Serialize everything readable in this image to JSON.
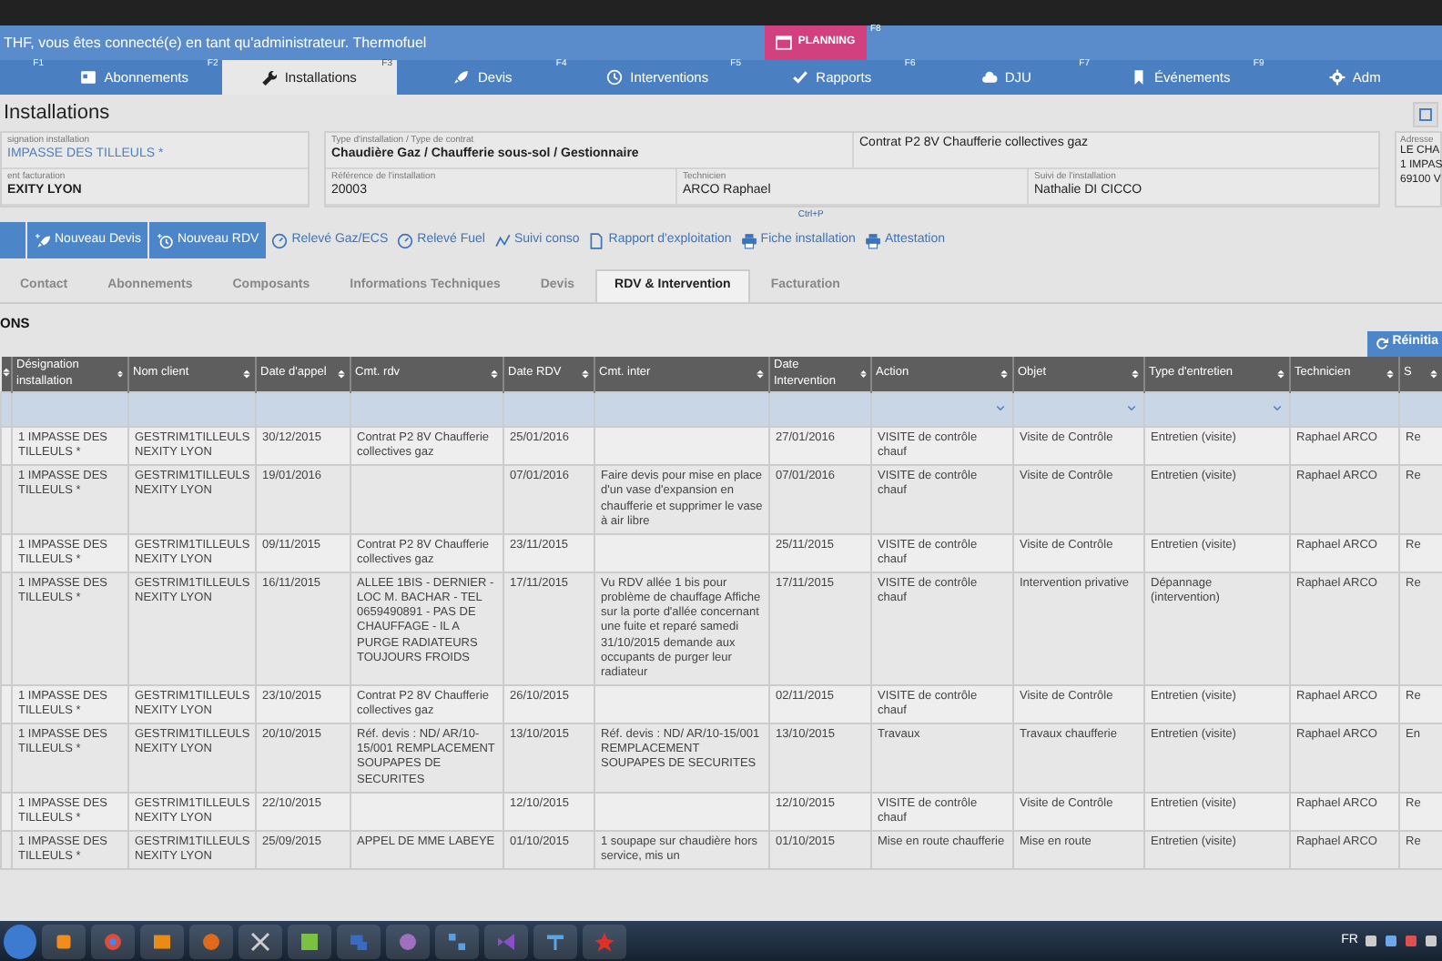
{
  "header": {
    "welcome": "THF, vous êtes connecté(e) en tant qu'administrateur. Thermofuel",
    "planning": {
      "label": "PLANNING",
      "key": "F8"
    }
  },
  "nav": [
    {
      "key": "F1",
      "selected": false
    },
    {
      "label": "Abonnements",
      "key": "F2",
      "selected": false
    },
    {
      "label": "Installations",
      "key": "F3",
      "selected": true
    },
    {
      "label": "Devis",
      "key": "F4",
      "selected": false
    },
    {
      "label": "Interventions",
      "key": "F5",
      "selected": false
    },
    {
      "label": "Rapports",
      "key": "F6",
      "selected": false
    },
    {
      "label": "DJU",
      "key": "F7",
      "selected": false
    },
    {
      "label": "Événements",
      "key": "F9",
      "selected": false
    },
    {
      "label": "Adm",
      "selected": false
    }
  ],
  "page_title": "Installations",
  "info": {
    "left": [
      {
        "label": "signation installation",
        "value": "IMPASSE DES TILLEULS *",
        "kind": "link"
      },
      {
        "label": "ent facturation",
        "value": "EXITY LYON",
        "kind": "bold"
      }
    ],
    "type": {
      "label": "Type d'installation / Type de contrat",
      "value": "Chaudière Gaz / Chaufferie sous-sol / Gestionnaire"
    },
    "contract": "Contrat P2 8V Chaufferie collectives gaz",
    "details": [
      {
        "label": "Référence de l'installation",
        "value": "20003"
      },
      {
        "label": "Technicien",
        "value": "ARCO Raphael"
      },
      {
        "label": "Suivi de l'installation",
        "value": "Nathalie DI CICCO"
      }
    ],
    "address": {
      "label": "Adresse",
      "lines": [
        "LE CHA",
        "1 IMPAS",
        "69100 V"
      ]
    }
  },
  "toolbar": [
    {
      "kind": "primary"
    },
    {
      "kind": "primary",
      "label": "Nouveau Devis"
    },
    {
      "kind": "primary",
      "label": "Nouveau RDV"
    },
    {
      "kind": "link",
      "label": "Relevé Gaz/ECS"
    },
    {
      "kind": "link",
      "label": "Relevé Fuel"
    },
    {
      "kind": "link",
      "label": "Suivi conso"
    },
    {
      "kind": "link",
      "label": "Rapport d'exploitation"
    },
    {
      "kind": "link",
      "label": "Fiche installation",
      "hint": "Ctrl+P"
    },
    {
      "kind": "link",
      "label": "Attestation"
    }
  ],
  "subtabs": [
    {
      "label": "Contact",
      "selected": false
    },
    {
      "label": "Abonnements",
      "selected": false
    },
    {
      "label": "Composants",
      "selected": false
    },
    {
      "label": "Informations Techniques",
      "selected": false
    },
    {
      "label": "Devis",
      "selected": false
    },
    {
      "label": "RDV & Intervention",
      "selected": true
    },
    {
      "label": "Facturation",
      "selected": false
    }
  ],
  "section_title": "ONS",
  "reset_button": "Réinitia",
  "table": {
    "columns": [
      {
        "label": "Désignation installation",
        "dropdown": false
      },
      {
        "label": "Nom client",
        "dropdown": false
      },
      {
        "label": "Date d'appel",
        "dropdown": false
      },
      {
        "label": "Cmt. rdv",
        "dropdown": false
      },
      {
        "label": "Date RDV",
        "dropdown": false
      },
      {
        "label": "Cmt. inter",
        "dropdown": false
      },
      {
        "label": "Date Intervention",
        "dropdown": false
      },
      {
        "label": "Action",
        "dropdown": true
      },
      {
        "label": "Objet",
        "dropdown": true
      },
      {
        "label": "Type d'entretien",
        "dropdown": true
      },
      {
        "label": "Technicien",
        "dropdown": false
      },
      {
        "label": "S",
        "dropdown": false
      }
    ],
    "rows": [
      [
        "1 IMPASSE DES TILLEULS *",
        "GESTRIM1TILLEULS NEXITY LYON",
        "30/12/2015",
        "Contrat P2 8V Chaufferie collectives gaz",
        "25/01/2016",
        null,
        "27/01/2016",
        "VISITE de contrôle chauf",
        "Visite de Contrôle",
        "Entretien (visite)",
        "Raphael ARCO",
        "Re"
      ],
      [
        "1 IMPASSE DES TILLEULS *",
        "GESTRIM1TILLEULS NEXITY LYON",
        "19/01/2016",
        null,
        "07/01/2016",
        "Faire devis pour mise en place d'un vase d'expansion en chaufferie et supprimer le vase à air libre",
        "07/01/2016",
        "VISITE de contrôle chauf",
        "Visite de Contrôle",
        "Entretien (visite)",
        "Raphael ARCO",
        "Re"
      ],
      [
        "1 IMPASSE DES TILLEULS *",
        "GESTRIM1TILLEULS NEXITY LYON",
        "09/11/2015",
        "Contrat P2 8V Chaufferie collectives gaz",
        "23/11/2015",
        null,
        "25/11/2015",
        "VISITE de contrôle chauf",
        "Visite de Contrôle",
        "Entretien (visite)",
        "Raphael ARCO",
        "Re"
      ],
      [
        "1 IMPASSE DES TILLEULS *",
        "GESTRIM1TILLEULS NEXITY LYON",
        "16/11/2015",
        "ALLEE 1BIS - DERNIER - LOC M. BACHAR - TEL 0659490891 - PAS DE CHAUFFAGE - IL A PURGE RADIATEURS TOUJOURS FROIDS",
        "17/11/2015",
        "Vu RDV allée 1 bis pour problème de chauffage Affiche sur la porte d'allée concernant une fuite et reparé samedi 31/10/2015 demande aux occupants de purger leur radiateur",
        "17/11/2015",
        "VISITE de contrôle chauf",
        "Intervention privative",
        "Dépannage (intervention)",
        "Raphael ARCO",
        "Re"
      ],
      [
        "1 IMPASSE DES TILLEULS *",
        "GESTRIM1TILLEULS NEXITY LYON",
        "23/10/2015",
        "Contrat P2 8V Chaufferie collectives gaz",
        "26/10/2015",
        null,
        "02/11/2015",
        "VISITE de contrôle chauf",
        "Visite de Contrôle",
        "Entretien (visite)",
        "Raphael ARCO",
        "Re"
      ],
      [
        "1 IMPASSE DES TILLEULS *",
        "GESTRIM1TILLEULS NEXITY LYON",
        "20/10/2015",
        "Réf. devis : ND/ AR/10-15/001 REMPLACEMENT SOUPAPES DE SECURITES",
        "13/10/2015",
        "Réf. devis : ND/ AR/10-15/001 REMPLACEMENT SOUPAPES DE SECURITES",
        "13/10/2015",
        "Travaux",
        "Travaux chaufferie",
        "Entretien (visite)",
        "Raphael ARCO",
        "En"
      ],
      [
        "1 IMPASSE DES TILLEULS *",
        "GESTRIM1TILLEULS NEXITY LYON",
        "22/10/2015",
        null,
        "12/10/2015",
        null,
        "12/10/2015",
        "VISITE de contrôle chauf",
        "Visite de Contrôle",
        "Entretien (visite)",
        "Raphael ARCO",
        "Re"
      ],
      [
        "1 IMPASSE DES TILLEULS *",
        "GESTRIM1TILLEULS NEXITY LYON",
        "25/09/2015",
        "APPEL DE MME LABEYE",
        "01/10/2015",
        "1 soupape sur chaudière hors service, mis un",
        "01/10/2015",
        "Mise en route chaufferie",
        "Mise en route",
        "Entretien (visite)",
        "Raphael ARCO",
        "Re"
      ]
    ]
  },
  "taskbar": {
    "language": "FR"
  }
}
